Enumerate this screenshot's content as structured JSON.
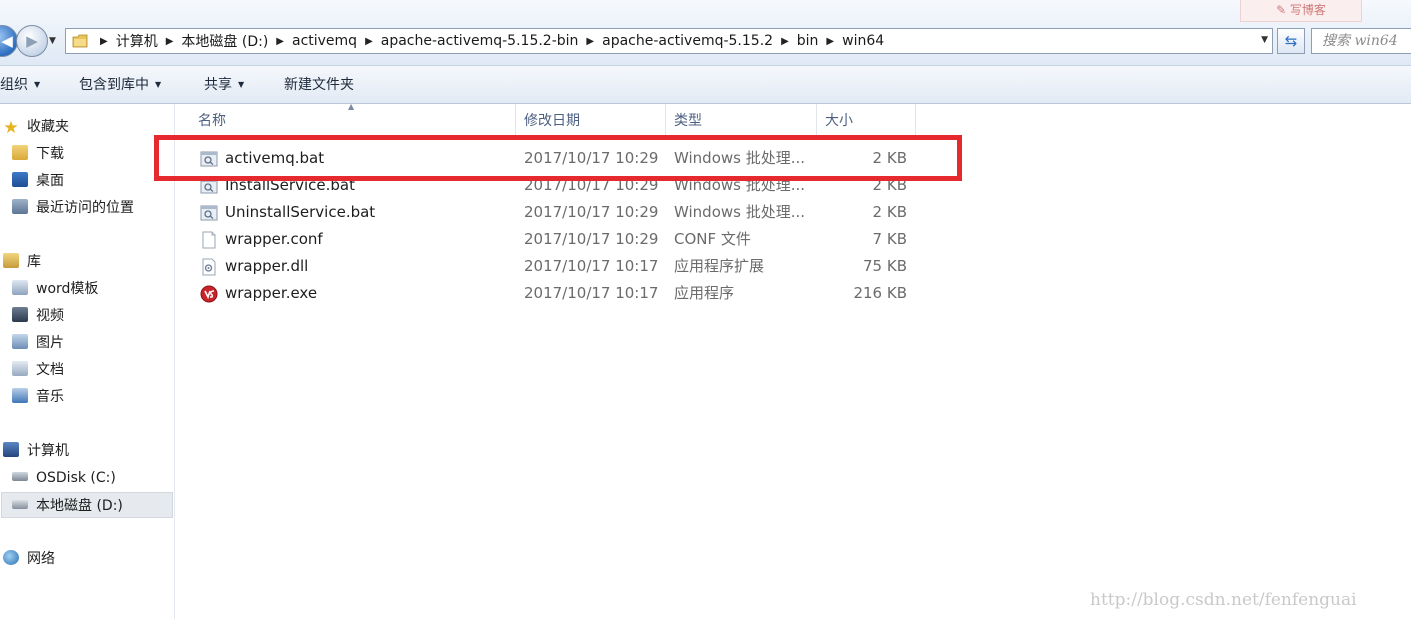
{
  "window": {
    "top_button_text": "✎ 写博客"
  },
  "address_bar": {
    "crumbs": [
      "计算机",
      "本地磁盘 (D:)",
      "activemq",
      "apache-activemq-5.15.2-bin",
      "apache-activemq-5.15.2",
      "bin",
      "win64"
    ],
    "search_placeholder": "搜索 win64"
  },
  "toolbar": {
    "organize": "组织",
    "include_library": "包含到库中",
    "share": "共享",
    "new_folder": "新建文件夹"
  },
  "sidebar": {
    "favorites": "收藏夹",
    "downloads": "下载",
    "desktop": "桌面",
    "recent": "最近访问的位置",
    "libraries": "库",
    "word_templates": "word模板",
    "videos": "视频",
    "pictures": "图片",
    "documents": "文档",
    "music": "音乐",
    "computer": "计算机",
    "drive_c": "OSDisk (C:)",
    "drive_d": "本地磁盘 (D:)",
    "network": "网络"
  },
  "columns": {
    "name": "名称",
    "modified": "修改日期",
    "type": "类型",
    "size": "大小"
  },
  "files": [
    {
      "name": "activemq.bat",
      "modified": "2017/10/17 10:29",
      "type": "Windows 批处理...",
      "size": "2 KB",
      "icon": "batch-file-icon"
    },
    {
      "name": "InstallService.bat",
      "modified": "2017/10/17 10:29",
      "type": "Windows 批处理...",
      "size": "2 KB",
      "icon": "batch-file-icon"
    },
    {
      "name": "UninstallService.bat",
      "modified": "2017/10/17 10:29",
      "type": "Windows 批处理...",
      "size": "2 KB",
      "icon": "batch-file-icon"
    },
    {
      "name": "wrapper.conf",
      "modified": "2017/10/17 10:29",
      "type": "CONF 文件",
      "size": "7 KB",
      "icon": "blank-file-icon"
    },
    {
      "name": "wrapper.dll",
      "modified": "2017/10/17 10:17",
      "type": "应用程序扩展",
      "size": "75 KB",
      "icon": "dll-file-icon"
    },
    {
      "name": "wrapper.exe",
      "modified": "2017/10/17 10:17",
      "type": "应用程序",
      "size": "216 KB",
      "icon": "exe-app-icon"
    }
  ],
  "colors": {
    "highlight": "#e6282f",
    "header_text": "#4d6082"
  },
  "watermark": "http://blog.csdn.net/fenfenguai"
}
